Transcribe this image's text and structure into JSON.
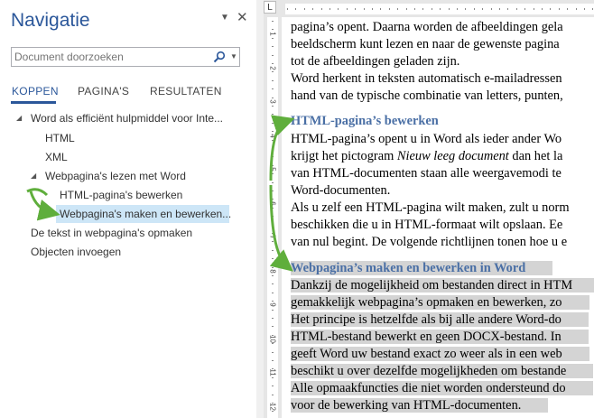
{
  "nav": {
    "title": "Navigatie",
    "search_placeholder": "Document doorzoeken",
    "tabs": [
      {
        "label": "KOPPEN",
        "active": true
      },
      {
        "label": "PAGINA'S",
        "active": false
      },
      {
        "label": "RESULTATEN",
        "active": false
      }
    ],
    "tree": [
      {
        "label": "Word als efficiënt hulpmiddel voor Inte...",
        "level": 0,
        "expanded": true
      },
      {
        "label": "HTML",
        "level": 1
      },
      {
        "label": "XML",
        "level": 1
      },
      {
        "label": "Webpagina's lezen met Word",
        "level": 1,
        "expanded": true
      },
      {
        "label": "HTML-pagina's bewerken",
        "level": 2
      },
      {
        "label": "Webpagina's maken en bewerken...",
        "level": 2,
        "selected": true
      },
      {
        "label": "De tekst in webpagina's opmaken",
        "level": 0
      },
      {
        "label": "Objecten invoegen",
        "level": 0
      }
    ]
  },
  "ruler": {
    "corner": "L",
    "vertical_numbers": [
      "1",
      "2",
      "3",
      "4",
      "5",
      "6",
      "7",
      "8",
      "9",
      "10",
      "11",
      "12"
    ]
  },
  "document": {
    "lines": [
      {
        "text": "pagina’s opent. Daarna worden de afbeeldingen gela"
      },
      {
        "text": "beeldscherm kunt lezen en naar de gewenste pagina"
      },
      {
        "text": "tot de afbeeldingen geladen zijn."
      },
      {
        "text": "Word herkent in teksten automatisch e-mailadressen"
      },
      {
        "text": "hand van de typische combinatie van letters, punten,"
      },
      {
        "text": "HTML-pagina’s bewerken",
        "heading": true
      },
      {
        "text": "HTML-pagina’s opent u in Word als ieder ander Wo"
      },
      {
        "pre": "krijgt het pictogram ",
        "em": "Nieuw leeg document",
        "post": " dan het la"
      },
      {
        "text": "van HTML-documenten staan alle weergavemodi te"
      },
      {
        "text": "Word-documenten."
      },
      {
        "text": "Als u zelf een HTML-pagina wilt maken, zult u norm"
      },
      {
        "text": "beschikken die u in HTML-formaat wilt opslaan. Ee"
      },
      {
        "text": "van nul begint. De volgende richtlijnen tonen hoe u e"
      },
      {
        "text": "Webpagina’s maken en bewerken in Word",
        "heading": true,
        "highlight": true
      },
      {
        "text": "Dankzij de mogelijkheid om bestanden direct in HTM",
        "highlight": true
      },
      {
        "text": "gemakkelijk webpagina’s opmaken en bewerken, zo",
        "highlight": true
      },
      {
        "text": "Het principe is hetzelfde als bij alle andere Word-do",
        "highlight": true
      },
      {
        "text": "HTML-bestand bewerkt en geen DOCX-bestand. In",
        "highlight": true
      },
      {
        "text": "geeft Word uw bestand exact zo weer als in een web",
        "highlight": true
      },
      {
        "text": "beschikt u over dezelfde mogelijkheden om bestande",
        "highlight": true
      },
      {
        "text": "Alle opmaakfuncties die niet worden ondersteund do",
        "highlight": true
      },
      {
        "text": "voor de bewerking van HTML-documenten.",
        "highlight": true
      }
    ]
  },
  "colors": {
    "accent": "#2b579a",
    "heading": "#4a6fa5",
    "annotation_arrow": "#5fae3c",
    "selection_nav": "#cde6f7",
    "selection_doc": "#d4d4d4"
  },
  "icons": {
    "search": "magnifier-icon",
    "pane_options": "triangle-down-icon",
    "close": "close-icon"
  }
}
